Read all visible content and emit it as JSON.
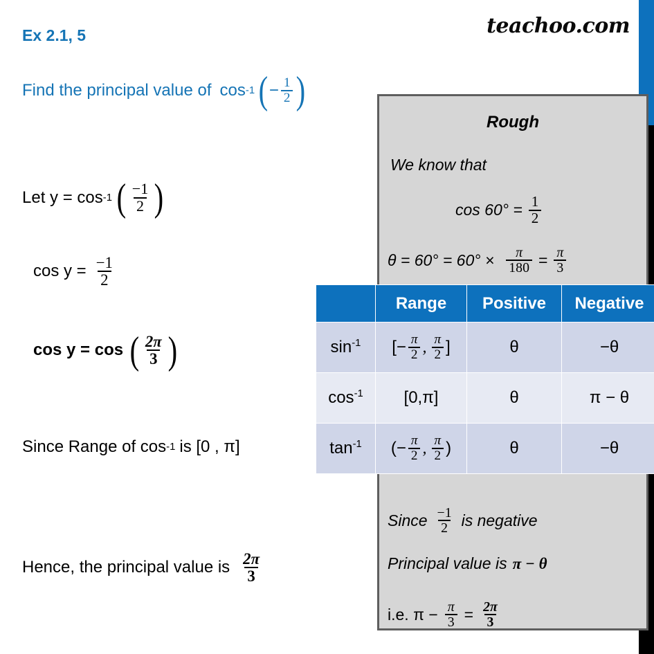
{
  "brand": {
    "name": "teachoo.com"
  },
  "header": {
    "exercise_title": "Ex 2.1, 5",
    "question_prefix": "Find the principal value of",
    "question_fn": "cos",
    "question_sup": "-1",
    "question_sign": "−",
    "question_num": "1",
    "question_den": "2"
  },
  "solution": {
    "step1": {
      "lead": "Let y = cos",
      "sup": "-1",
      "num": "−1",
      "den": "2"
    },
    "step2": {
      "lead": "cos y =",
      "num": "−1",
      "den": "2"
    },
    "step3": {
      "lead": "cos y = cos",
      "num": "2π",
      "den": "3"
    },
    "step4": {
      "text_a": "Since Range of cos",
      "sup": "-1",
      "text_b": "is [0 , π]"
    },
    "step5": {
      "lead": "Hence, the principal value is",
      "num": "2π",
      "den": "3"
    }
  },
  "rough": {
    "title": "Rough",
    "we_know_that": "We know that",
    "cos60": {
      "lead": "cos 60° =",
      "num": "1",
      "den": "2"
    },
    "theta": {
      "lead": "θ = 60° = 60° ×",
      "f1_num": "π",
      "f1_den": "180",
      "eq": "=",
      "f2_num": "π",
      "f2_den": "3"
    },
    "since": {
      "lead": "Since",
      "num": "−1",
      "den": "2",
      "tail": "is negative"
    },
    "principal": {
      "lead": "Principal value is",
      "value": "π − θ"
    },
    "ie": {
      "lead": "i.e. π −",
      "f1_num": "π",
      "f1_den": "3",
      "eq": "=",
      "f2_num": "2π",
      "f2_den": "3"
    }
  },
  "table": {
    "headers": [
      "",
      "Range",
      "Positive",
      "Negative"
    ],
    "rows": [
      {
        "fn": "sin",
        "fn_sup": "-1",
        "range_open": "[−",
        "range_n1": "π",
        "range_d1": "2",
        "range_mid": ",",
        "range_n2": "π",
        "range_d2": "2",
        "range_close": "]",
        "positive": "θ",
        "negative": "−θ"
      },
      {
        "fn": "cos",
        "fn_sup": "-1",
        "range_plain": "[0,π]",
        "positive": "θ",
        "negative": "π − θ"
      },
      {
        "fn": "tan",
        "fn_sup": "-1",
        "range_open": "(−",
        "range_n1": "π",
        "range_d1": "2",
        "range_mid": ",",
        "range_n2": "π",
        "range_d2": "2",
        "range_close": ")",
        "positive": "θ",
        "negative": "−θ"
      }
    ]
  },
  "colors": {
    "accent_blue": "#0D71BD",
    "heading_blue": "#1574B5",
    "row_odd": "#CFD5E8",
    "row_even": "#E7EAF3",
    "rough_bg": "#D6D6D6",
    "rough_border": "#5E5E5E",
    "bar_black": "#000000"
  }
}
